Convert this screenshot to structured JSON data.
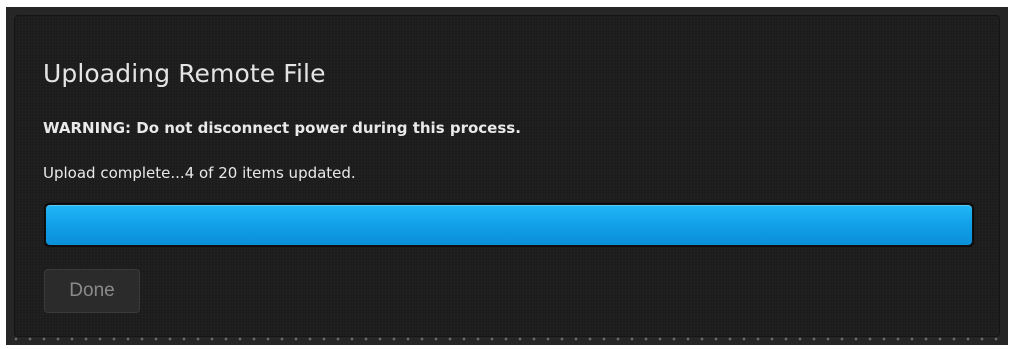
{
  "dialog": {
    "title": "Uploading Remote File",
    "warning": "WARNING: Do not disconnect power during this process.",
    "status": "Upload complete...4 of 20 items updated.",
    "progress_percent": 100,
    "done_label": "Done"
  },
  "colors": {
    "progress_fill": "#12a2ea",
    "panel_background": "#1b1b1b",
    "frame_background": "#262626"
  }
}
